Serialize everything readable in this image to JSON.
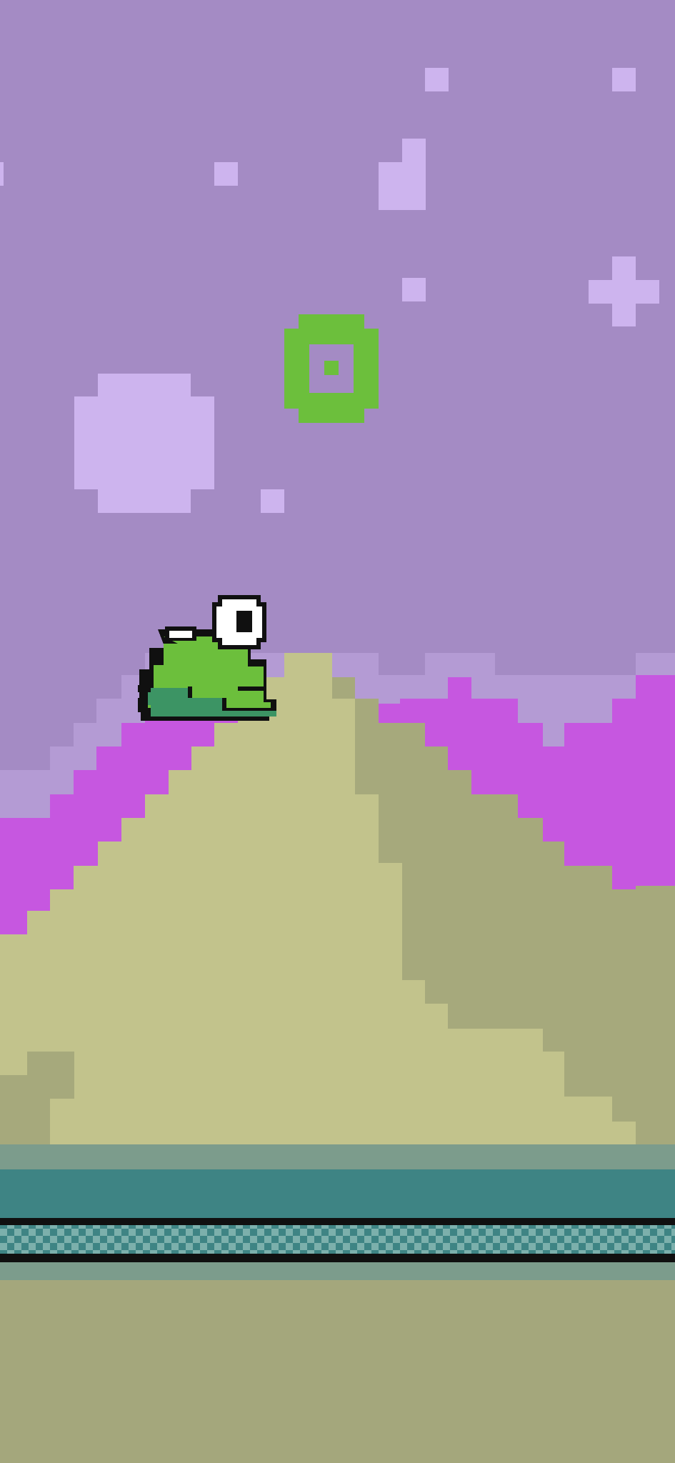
{
  "game": {
    "score": "0"
  },
  "colors": {
    "sky": "#a48bc4",
    "star": "#cdb4ee",
    "moon": "#cdb4ee",
    "distant_hills": "#b49bd4",
    "magenta_hills": "#c657e0",
    "pyramid_light": "#c2c38c",
    "pyramid_shadow": "#a6a97c",
    "water_top": "#7c9c8c",
    "water": "#3e8484",
    "checker_a": "#3e8484",
    "checker_b": "#7cb0ac",
    "ground": "#a4a77c",
    "score": "#6cbf3c",
    "frog_body": "#6cbf3c",
    "frog_dark": "#3c9464",
    "frog_outline": "#101010",
    "frog_eye": "#ffffff"
  },
  "sprites": {
    "player": "frog-sprite",
    "score_digits": "pixel-digit-font"
  }
}
